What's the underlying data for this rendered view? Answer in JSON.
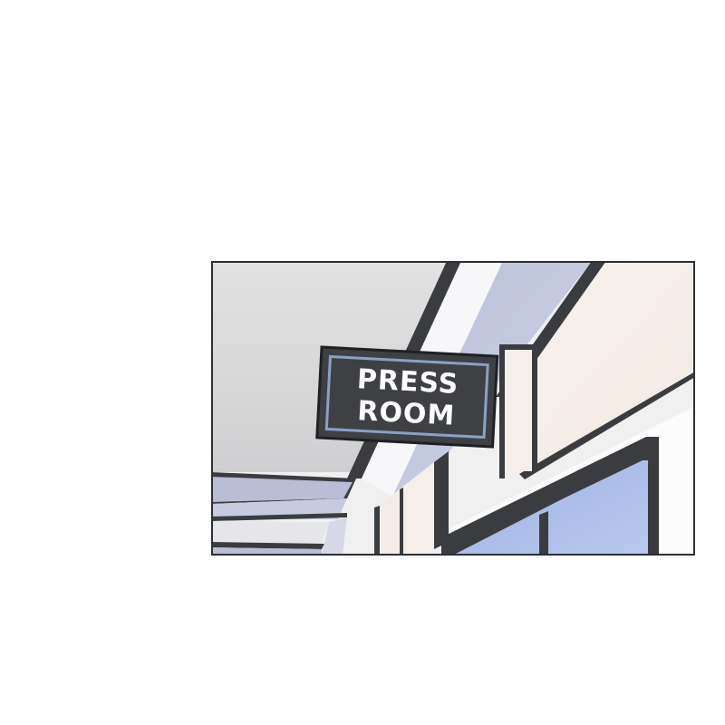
{
  "sign": {
    "line1": "PRESS",
    "line2": "ROOM"
  },
  "colors": {
    "background": "#ffffff",
    "panel_border": "#2e2f33",
    "ceiling": "#e3e3e3",
    "sign_face": "#3f4044",
    "sign_trim": "#8aa0c4",
    "window_glass": "#a9bde6",
    "wall": "#f8f1ec"
  }
}
